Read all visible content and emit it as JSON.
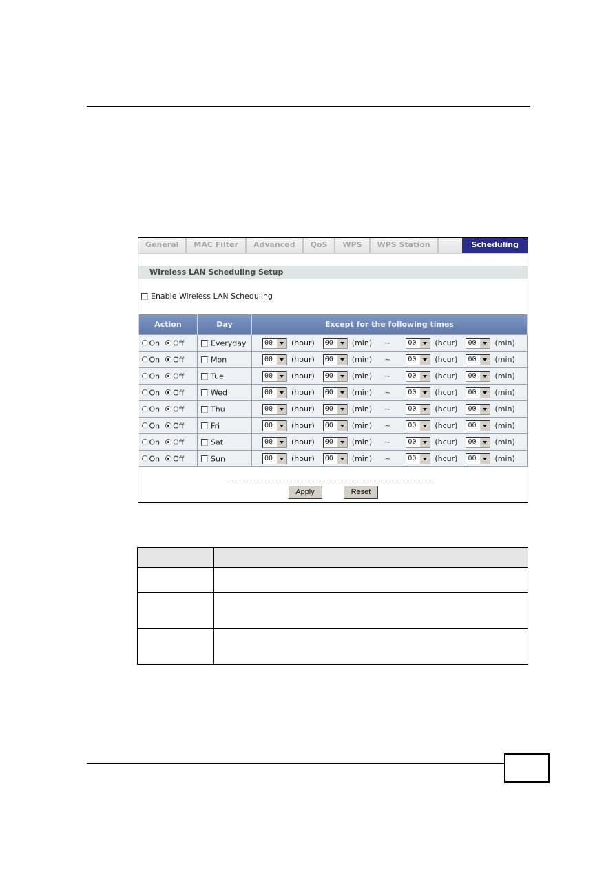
{
  "tabs": [
    {
      "label": "General",
      "active": false
    },
    {
      "label": "MAC Filter",
      "active": false
    },
    {
      "label": "Advanced",
      "active": false
    },
    {
      "label": "QoS",
      "active": false
    },
    {
      "label": "WPS",
      "active": false
    },
    {
      "label": "WPS Station",
      "active": false
    },
    {
      "label": "Scheduling",
      "active": true
    }
  ],
  "section_title": "Wireless LAN Scheduling Setup",
  "enable_label": "Enable Wireless LAN Scheduling",
  "enable_checked": false,
  "table": {
    "headers": [
      "Action",
      "Day",
      "Except for the following times"
    ],
    "on_label": "On",
    "off_label": "Off",
    "tilde": "~",
    "units": [
      "(hour)",
      "(min)",
      "(hcur)",
      "(min)"
    ],
    "rows": [
      {
        "day": "Everyday",
        "action": "Off",
        "checked": false,
        "times": [
          "00",
          "00",
          "00",
          "00"
        ]
      },
      {
        "day": "Mon",
        "action": "Off",
        "checked": false,
        "times": [
          "00",
          "00",
          "00",
          "00"
        ]
      },
      {
        "day": "Tue",
        "action": "Off",
        "checked": false,
        "times": [
          "00",
          "00",
          "00",
          "00"
        ]
      },
      {
        "day": "Wed",
        "action": "Off",
        "checked": false,
        "times": [
          "00",
          "00",
          "00",
          "00"
        ]
      },
      {
        "day": "Thu",
        "action": "Off",
        "checked": false,
        "times": [
          "00",
          "00",
          "00",
          "00"
        ]
      },
      {
        "day": "Fri",
        "action": "Off",
        "checked": false,
        "times": [
          "00",
          "00",
          "00",
          "00"
        ]
      },
      {
        "day": "Sat",
        "action": "Off",
        "checked": false,
        "times": [
          "00",
          "00",
          "00",
          "00"
        ]
      },
      {
        "day": "Sun",
        "action": "Off",
        "checked": false,
        "times": [
          "00",
          "00",
          "00",
          "00"
        ]
      }
    ]
  },
  "buttons": {
    "apply": "Apply",
    "reset": "Reset"
  },
  "colors": {
    "active_tab": "#2b2b8c",
    "table_header": "#6f88b8",
    "section_bg": "#dfe4e4"
  }
}
